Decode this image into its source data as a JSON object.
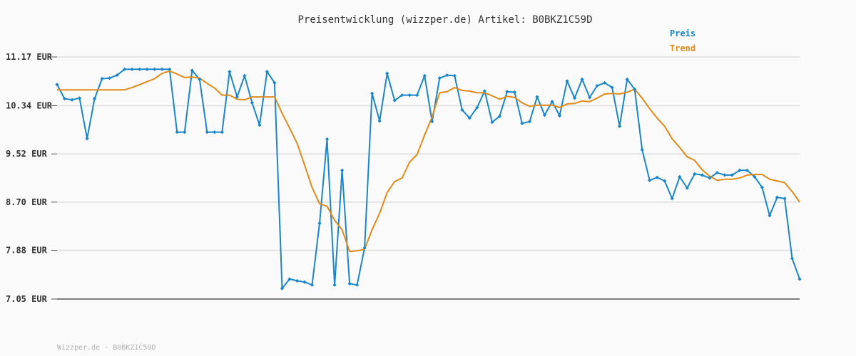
{
  "chart_data": {
    "type": "line",
    "title": "Preisentwicklung (wizzper.de) Artikel: B0BKZ1C59D",
    "ylim": [
      7.05,
      11.17
    ],
    "yticks": [
      {
        "value": 11.17,
        "label": "11.17 EUR"
      },
      {
        "value": 10.34,
        "label": "10.34 EUR"
      },
      {
        "value": 9.52,
        "label": "9.52 EUR"
      },
      {
        "value": 8.7,
        "label": "8.70 EUR"
      },
      {
        "value": 7.88,
        "label": "7.88 EUR"
      },
      {
        "value": 7.05,
        "label": "7.05 EUR"
      }
    ],
    "grid": true,
    "legend_position": "top-right",
    "series": [
      {
        "name": "Preis",
        "color": "#1a85c8",
        "markers": true,
        "values": [
          10.7,
          10.46,
          10.44,
          10.47,
          9.78,
          10.46,
          10.8,
          10.81,
          10.86,
          10.96,
          10.96,
          10.96,
          10.96,
          10.96,
          10.96,
          10.96,
          9.89,
          9.89,
          10.94,
          10.79,
          9.89,
          9.89,
          9.89,
          10.92,
          10.49,
          10.85,
          10.39,
          10.01,
          10.92,
          10.73,
          7.23,
          7.39,
          7.36,
          7.34,
          7.29,
          8.34,
          9.77,
          7.29,
          9.24,
          7.31,
          7.29,
          7.92,
          10.55,
          10.08,
          10.89,
          10.43,
          10.52,
          10.52,
          10.52,
          10.85,
          10.07,
          10.81,
          10.86,
          10.85,
          10.27,
          10.13,
          10.31,
          10.59,
          10.06,
          10.16,
          10.58,
          10.57,
          10.04,
          10.07,
          10.49,
          10.18,
          10.41,
          10.17,
          10.76,
          10.47,
          10.79,
          10.48,
          10.68,
          10.73,
          10.65,
          9.99,
          10.79,
          10.62,
          9.59,
          9.07,
          9.12,
          9.06,
          8.76,
          9.13,
          8.94,
          9.18,
          9.16,
          9.11,
          9.2,
          9.16,
          9.16,
          9.24,
          9.24,
          9.13,
          8.95,
          8.47,
          8.78,
          8.76,
          7.74,
          7.39
        ]
      },
      {
        "name": "Trend",
        "color": "#e08a1a",
        "markers": false,
        "values": [
          10.61,
          10.61,
          10.61,
          10.61,
          10.61,
          10.61,
          10.61,
          10.61,
          10.61,
          10.61,
          10.65,
          10.7,
          10.75,
          10.8,
          10.89,
          10.93,
          10.88,
          10.82,
          10.83,
          10.81,
          10.72,
          10.64,
          10.52,
          10.52,
          10.45,
          10.44,
          10.49,
          10.49,
          10.49,
          10.49,
          10.21,
          9.96,
          9.7,
          9.33,
          8.95,
          8.67,
          8.63,
          8.39,
          8.23,
          7.86,
          7.87,
          7.9,
          8.23,
          8.51,
          8.86,
          9.05,
          9.11,
          9.38,
          9.51,
          9.84,
          10.15,
          10.56,
          10.58,
          10.65,
          10.6,
          10.59,
          10.56,
          10.56,
          10.51,
          10.45,
          10.5,
          10.48,
          10.39,
          10.33,
          10.35,
          10.35,
          10.35,
          10.31,
          10.37,
          10.38,
          10.42,
          10.41,
          10.47,
          10.54,
          10.55,
          10.54,
          10.57,
          10.62,
          10.47,
          10.29,
          10.13,
          9.99,
          9.78,
          9.63,
          9.47,
          9.41,
          9.25,
          9.14,
          9.07,
          9.09,
          9.09,
          9.11,
          9.16,
          9.17,
          9.17,
          9.09,
          9.06,
          9.03,
          8.88,
          8.7
        ]
      }
    ]
  },
  "footer": {
    "text": "Wizzper.de - B0BKZ1C59D"
  }
}
